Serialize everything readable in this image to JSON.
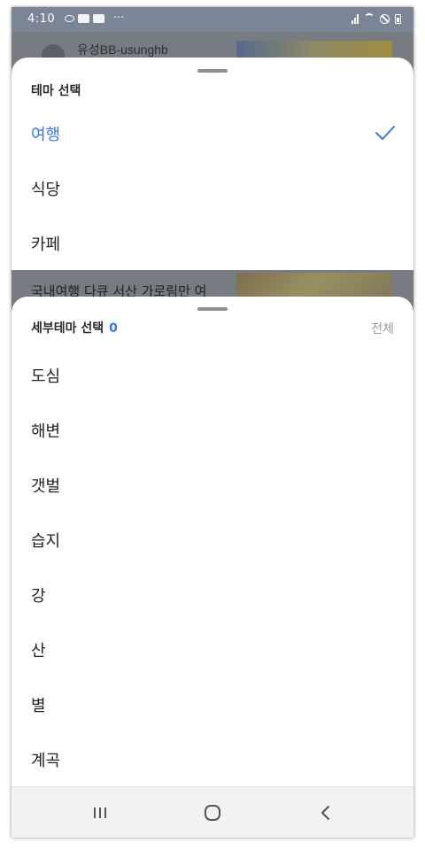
{
  "status_bar": {
    "time": "4:10",
    "more": "···"
  },
  "background_app": {
    "channel_name": "유성BB-usunghb",
    "video_title": "국내여행 다큐 서산 가로림만 여"
  },
  "theme_sheet": {
    "title": "테마 선택",
    "items": [
      {
        "label": "여행",
        "selected": true
      },
      {
        "label": "식당",
        "selected": false
      },
      {
        "label": "카페",
        "selected": false
      }
    ]
  },
  "subtheme_sheet": {
    "title": "세부테마 선택",
    "count": "0",
    "all_label": "전체",
    "items": [
      {
        "label": "도심"
      },
      {
        "label": "해변"
      },
      {
        "label": "갯벌"
      },
      {
        "label": "습지"
      },
      {
        "label": "강"
      },
      {
        "label": "산"
      },
      {
        "label": "별"
      },
      {
        "label": "계곡"
      }
    ]
  },
  "colors": {
    "accent": "#3a78e0",
    "text": "#222222",
    "muted": "#9b9b9b",
    "scrim": "#777c83",
    "navbar": "#f2f2f2"
  },
  "navigation_bar": {
    "icons": [
      "recent-apps-icon",
      "home-icon",
      "back-icon"
    ]
  }
}
